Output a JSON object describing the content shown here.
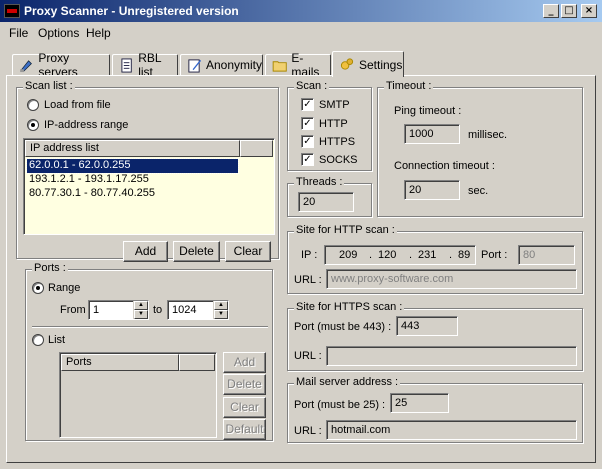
{
  "window": {
    "title": "Proxy Scanner - Unregistered version"
  },
  "menu": [
    "File",
    "Options",
    "Help"
  ],
  "tabs": [
    "Proxy servers",
    "RBL list",
    "Anonymity",
    "E-mails",
    "Settings"
  ],
  "scan_list": {
    "label": "Scan list :",
    "load_from_file": "Load from file",
    "ip_range": "IP-address range",
    "list_header": "IP address list",
    "items": [
      "62.0.0.1 - 62.0.0.255",
      "193.1.2.1 - 193.1.17.255",
      "80.77.30.1 - 80.77.40.255"
    ],
    "add": "Add",
    "delete": "Delete",
    "clear": "Clear"
  },
  "ports": {
    "label": "Ports :",
    "range": "Range",
    "from_label": "From",
    "from_value": "1",
    "to_label": "to",
    "to_value": "1024",
    "list": "List",
    "list_header": "Ports",
    "add": "Add",
    "delete": "Delete",
    "clear": "Clear",
    "default": "Default"
  },
  "scan": {
    "label": "Scan :",
    "items": [
      "SMTP",
      "HTTP",
      "HTTPS",
      "SOCKS"
    ]
  },
  "threads": {
    "label": "Threads :",
    "value": "20"
  },
  "timeout": {
    "label": "Timeout :",
    "ping_label": "Ping timeout :",
    "ping_value": "1000",
    "ping_unit": "millisec.",
    "conn_label": "Connection timeout :",
    "conn_value": "20",
    "conn_unit": "sec."
  },
  "http_site": {
    "label": "Site for HTTP scan :",
    "ip_label": "IP :",
    "ip": [
      "209",
      "120",
      "231",
      "89"
    ],
    "dot": ".",
    "port_label": "Port :",
    "port_value": "80",
    "url_label": "URL :",
    "url_value": "www.proxy-software.com"
  },
  "https_site": {
    "label": "Site for HTTPS scan :",
    "port_label": "Port (must be 443) :",
    "port_value": "443",
    "url_label": "URL :",
    "url_value": ""
  },
  "mail": {
    "label": "Mail server address :",
    "port_label": "Port (must be 25) :",
    "port_value": "25",
    "url_label": "URL :",
    "url_value": "hotmail.com"
  }
}
